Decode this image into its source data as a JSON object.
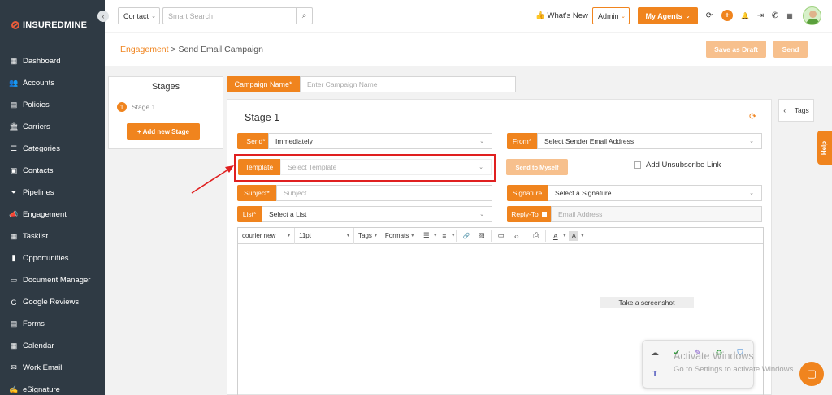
{
  "sidebar": {
    "logo_part1": "INSUREDMINE",
    "collapse_glyph": "‹",
    "items": [
      {
        "label": "Dashboard",
        "icon": "dashboard-icon",
        "glyph": "▦"
      },
      {
        "label": "Accounts",
        "icon": "accounts-icon",
        "glyph": "👥"
      },
      {
        "label": "Policies",
        "icon": "policies-icon",
        "glyph": "▤"
      },
      {
        "label": "Carriers",
        "icon": "carriers-icon",
        "glyph": "🏛"
      },
      {
        "label": "Categories",
        "icon": "categories-icon",
        "glyph": "☰"
      },
      {
        "label": "Contacts",
        "icon": "contacts-icon",
        "glyph": "▣"
      },
      {
        "label": "Pipelines",
        "icon": "pipelines-icon",
        "glyph": "⏷"
      },
      {
        "label": "Engagement",
        "icon": "engagement-icon",
        "glyph": "📣"
      },
      {
        "label": "Tasklist",
        "icon": "tasklist-icon",
        "glyph": "▦"
      },
      {
        "label": "Opportunities",
        "icon": "opportunities-icon",
        "glyph": "▮"
      },
      {
        "label": "Document Manager",
        "icon": "document-manager-icon",
        "glyph": "▭"
      },
      {
        "label": "Google Reviews",
        "icon": "google-reviews-icon",
        "glyph": "G"
      },
      {
        "label": "Forms",
        "icon": "forms-icon",
        "glyph": "▤"
      },
      {
        "label": "Calendar",
        "icon": "calendar-icon",
        "glyph": "▦"
      },
      {
        "label": "Work Email",
        "icon": "work-email-icon",
        "glyph": "✉"
      },
      {
        "label": "eSignature",
        "icon": "esignature-icon",
        "glyph": "✍"
      }
    ]
  },
  "topbar": {
    "contact_select": "Contact",
    "search_placeholder": "Smart Search",
    "search_glyph": "⌕",
    "whats_new": "What's New",
    "admin_select": "Admin",
    "my_agents": "My Agents",
    "chevron_glyph": "⌄",
    "icons": {
      "sync": "⟳",
      "plus": "+",
      "bell": "🔔",
      "logout": "⇥",
      "phone": "✆",
      "calculator": "▦"
    }
  },
  "header": {
    "breadcrumb_link": "Engagement",
    "breadcrumb_sep": " > ",
    "breadcrumb_current": "Send Email Campaign",
    "save_draft": "Save as Draft",
    "send": "Send"
  },
  "stages": {
    "title": "Stages",
    "items": [
      {
        "number": "1",
        "label": "Stage 1"
      }
    ],
    "add_button": "+ Add new Stage"
  },
  "campaign": {
    "label": "Campaign Name*",
    "placeholder": "Enter Campaign Name"
  },
  "stage_card": {
    "title": "Stage 1",
    "refresh_glyph": "⟳",
    "send_label": "Send*",
    "send_value": "Immediately",
    "from_label": "From*",
    "from_value": "Select Sender Email Address",
    "template_label": "Template",
    "template_placeholder": "Select Template",
    "send_to_myself": "Send to Myself",
    "add_unsubscribe": "Add Unsubscribe Link",
    "subject_label": "Subject*",
    "subject_placeholder": "Subject",
    "signature_label": "Signature",
    "signature_value": "Select a Signature",
    "list_label": "List*",
    "list_value": "Select a List",
    "reply_to_label": "Reply-To",
    "reply_to_placeholder": "Email Address"
  },
  "editor": {
    "font": "courier new",
    "size": "11pt",
    "tags": "Tags",
    "formats": "Formats",
    "icons": {
      "bullet_list": "☰",
      "numbered_list": "≡",
      "link": "🔗",
      "image": "▨",
      "media": "▭",
      "code": "‹›",
      "print": "⎙",
      "text_color": "A",
      "bg_color": "A"
    },
    "tooltip": "Take a screenshot"
  },
  "side_tabs": {
    "tags_chevron": "‹",
    "tags": "Tags",
    "help": "Help"
  },
  "os_overlay": {
    "activate_title": "Activate Windows",
    "activate_sub": "Go to Settings to activate Windows.",
    "tray_icons": [
      "☁",
      "✔",
      "✎",
      "♻",
      "⛉",
      "T"
    ]
  },
  "colors": {
    "accent": "#f0841e",
    "sidebar_bg": "#2f3a44",
    "highlight": "#e02020"
  }
}
